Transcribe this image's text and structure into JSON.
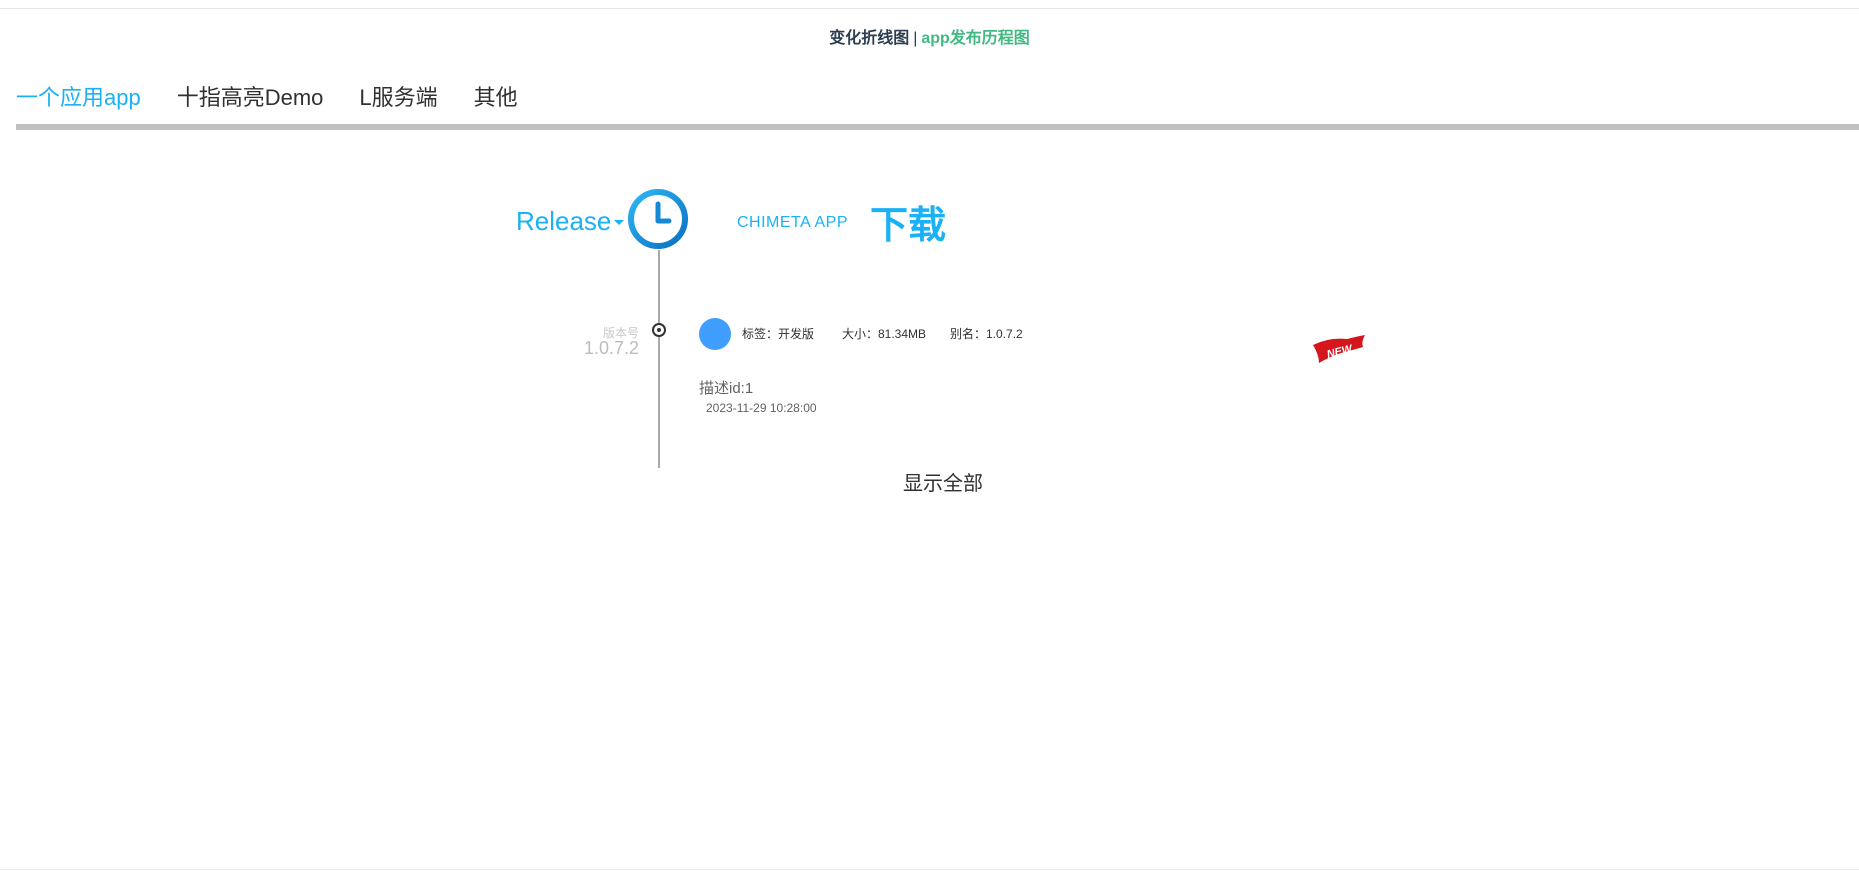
{
  "header": {
    "line_chart_link": "变化折线图",
    "separator": "|",
    "history_link": "app发布历程图"
  },
  "tabs": [
    {
      "label": "一个应用app",
      "active": true
    },
    {
      "label": "十指高亮Demo",
      "active": false
    },
    {
      "label": "L服务端",
      "active": false
    },
    {
      "label": "其他",
      "active": false
    }
  ],
  "release": {
    "label": "Release",
    "app_name": "CHIMETA APP",
    "download_label": "下载"
  },
  "entry": {
    "version_caption": "版本号",
    "version": "1.0.7.2",
    "tag_text": "标签：开发版",
    "size_text": "大小：81.34MB",
    "alias_text": "别名：1.0.7.2",
    "description": "描述id:1",
    "timestamp": "2023-11-29 10:28:00",
    "badge": "NEW"
  },
  "show_all_label": "显示全部",
  "colors": {
    "accent": "#1ab1f5",
    "link_green": "#42b983",
    "avatar": "#409eff",
    "badge_red": "#d4171d"
  }
}
